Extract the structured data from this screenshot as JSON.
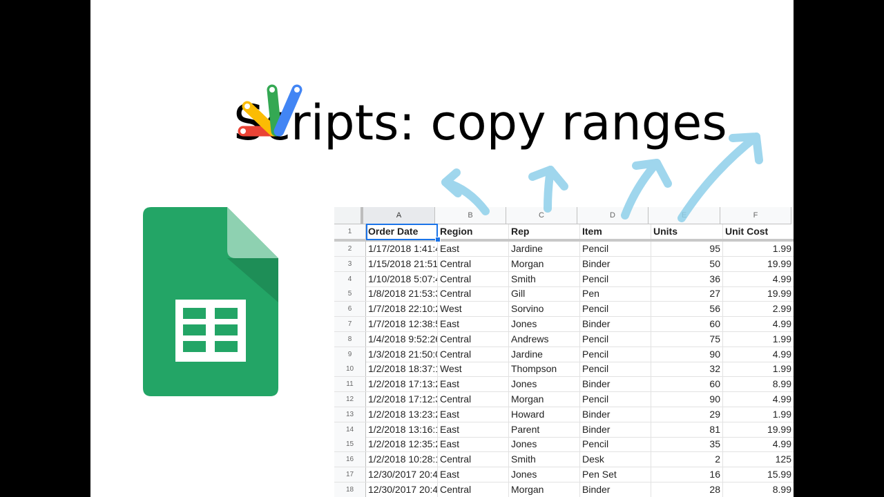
{
  "slide": {
    "title": "Scripts: copy ranges"
  },
  "icons": {
    "apps_script": "apps-script-logo",
    "sheets": "google-sheets-logo"
  },
  "colors": {
    "sheets_green": "#23a566",
    "sheets_dark": "#1e8e57",
    "sheets_fold": "#8ed1b1",
    "arrow_blue": "#8fd0ea",
    "selection": "#1a73e8"
  },
  "sheet": {
    "columns": [
      "A",
      "B",
      "C",
      "D",
      "E",
      "F"
    ],
    "header": [
      "Order Date",
      "Region",
      "Rep",
      "Item",
      "Units",
      "Unit Cost"
    ],
    "rows": [
      {
        "n": "2",
        "cells": [
          "1/17/2018 1:41:4",
          "East",
          "Jardine",
          "Pencil",
          "95",
          "1.99"
        ]
      },
      {
        "n": "3",
        "cells": [
          "1/15/2018 21:51:",
          "Central",
          "Morgan",
          "Binder",
          "50",
          "19.99"
        ]
      },
      {
        "n": "4",
        "cells": [
          "1/10/2018 5:07:4",
          "Central",
          "Smith",
          "Pencil",
          "36",
          "4.99"
        ]
      },
      {
        "n": "5",
        "cells": [
          "1/8/2018 21:53:3",
          "Central",
          "Gill",
          "Pen",
          "27",
          "19.99"
        ]
      },
      {
        "n": "6",
        "cells": [
          "1/7/2018 22:10:2",
          "West",
          "Sorvino",
          "Pencil",
          "56",
          "2.99"
        ]
      },
      {
        "n": "7",
        "cells": [
          "1/7/2018 12:38:5",
          "East",
          "Jones",
          "Binder",
          "60",
          "4.99"
        ]
      },
      {
        "n": "8",
        "cells": [
          "1/4/2018 9:52:26",
          "Central",
          "Andrews",
          "Pencil",
          "75",
          "1.99"
        ]
      },
      {
        "n": "9",
        "cells": [
          "1/3/2018 21:50:0",
          "Central",
          "Jardine",
          "Pencil",
          "90",
          "4.99"
        ]
      },
      {
        "n": "10",
        "cells": [
          "1/2/2018 18:37:1",
          "West",
          "Thompson",
          "Pencil",
          "32",
          "1.99"
        ]
      },
      {
        "n": "11",
        "cells": [
          "1/2/2018 17:13:2",
          "East",
          "Jones",
          "Binder",
          "60",
          "8.99"
        ]
      },
      {
        "n": "12",
        "cells": [
          "1/2/2018 17:12:3",
          "Central",
          "Morgan",
          "Pencil",
          "90",
          "4.99"
        ]
      },
      {
        "n": "13",
        "cells": [
          "1/2/2018 13:23:2",
          "East",
          "Howard",
          "Binder",
          "29",
          "1.99"
        ]
      },
      {
        "n": "14",
        "cells": [
          "1/2/2018 13:16:1",
          "East",
          "Parent",
          "Binder",
          "81",
          "19.99"
        ]
      },
      {
        "n": "15",
        "cells": [
          "1/2/2018 12:35:2",
          "East",
          "Jones",
          "Pencil",
          "35",
          "4.99"
        ]
      },
      {
        "n": "16",
        "cells": [
          "1/2/2018 10:28:1",
          "Central",
          "Smith",
          "Desk",
          "2",
          "125"
        ]
      },
      {
        "n": "17",
        "cells": [
          "12/30/2017 20:4:",
          "East",
          "Jones",
          "Pen Set",
          "16",
          "15.99"
        ]
      },
      {
        "n": "18",
        "cells": [
          "12/30/2017 20:4:",
          "Central",
          "Morgan",
          "Binder",
          "28",
          "8.99"
        ]
      }
    ],
    "header_row_number": "1"
  }
}
